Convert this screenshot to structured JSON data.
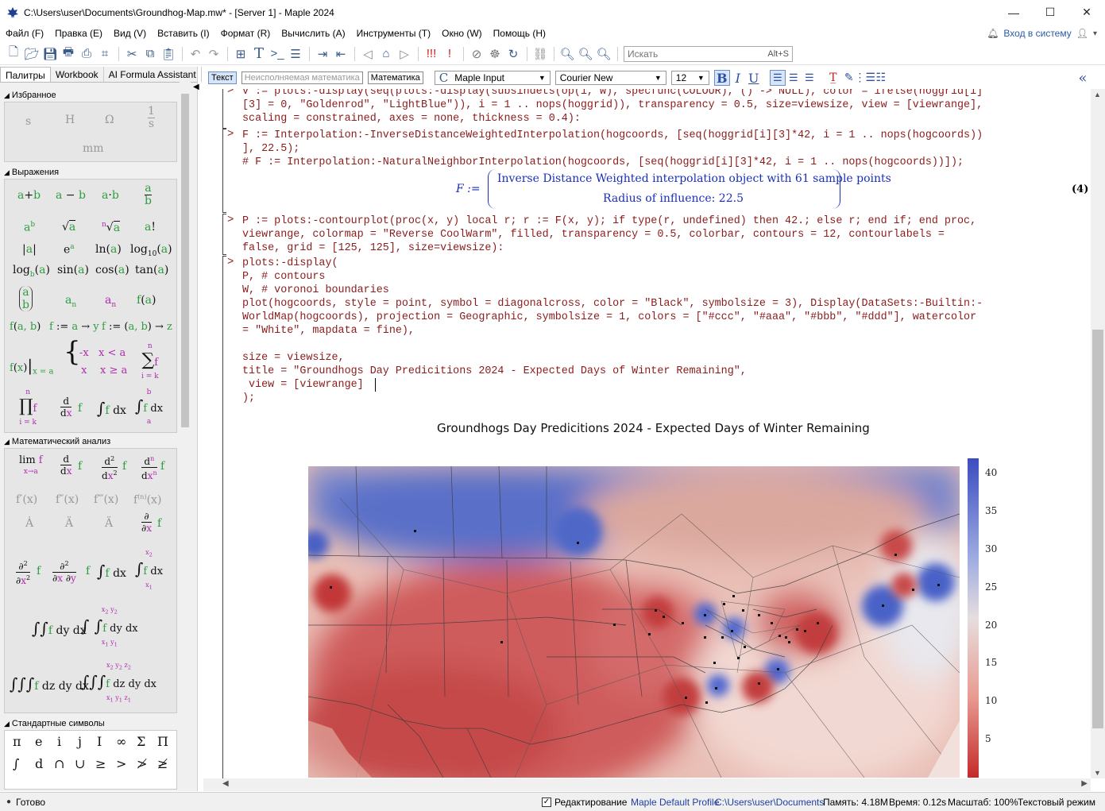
{
  "window": {
    "title": "C:\\Users\\user\\Documents\\Groundhog-Map.mw* - [Server 1] - Maple 2024",
    "minimize": "—",
    "maximize": "☐",
    "close": "✕"
  },
  "menu": [
    "Файл (F)",
    "Правка (E)",
    "Вид (V)",
    "Вставить (I)",
    "Формат (R)",
    "Вычислить (A)",
    "Инструменты (T)",
    "Окно (W)",
    "Помощь (H)"
  ],
  "login": "Вход в систему",
  "search": {
    "placeholder": "Искать",
    "shortcut": "Alt+S"
  },
  "palette": {
    "tabs": [
      "Палитры",
      "Workbook",
      "AI Formula Assistant"
    ],
    "sections": {
      "favorites": "Избранное",
      "expressions": "Выражения",
      "calculus": "Математический анализ",
      "symbols": "Стандартные символы"
    },
    "favorites_items": [
      "s",
      "H",
      "Ω",
      "mm"
    ],
    "symbols_row1": [
      "π",
      "e",
      "i",
      "j",
      "I",
      "∞",
      "Σ",
      "Π"
    ],
    "symbols_row2": [
      "∫",
      "d",
      "∩",
      "∪",
      "≥",
      ">",
      "≯",
      "≱"
    ]
  },
  "format_bar": {
    "text_mode": "Текст",
    "nonexec_math": "Неисполняемая математика",
    "math_mode": "Математика",
    "style": "Maple Input",
    "font": "Courier New",
    "size": "12",
    "bold": "B",
    "italic": "I",
    "underline": "U"
  },
  "document": {
    "lines_block1": [
      "V := plots:-display(seq(plots:-display(subsindets(op(1, w), specfunc(COLOUR), () -> NULL), color = ifelse(hoggrid[i]",
      "[3] = 0, \"Goldenrod\", \"LightBlue\")), i = 1 .. nops(hoggrid)), transparency = 0.5, size=viewsize, view = [viewrange],",
      "scaling = constrained, axes = none, thickness = 0.4):"
    ],
    "lines_block2": [
      "F := Interpolation:-InverseDistanceWeightedInterpolation(hogcoords, [seq(hoggrid[i][3]*42, i = 1 .. nops(hogcoords))",
      "], 22.5);",
      "# F := Interpolation:-NaturalNeighborInterpolation(hogcoords, [seq(hoggrid[i][3]*42, i = 1 .. nops(hogcoords))]);"
    ],
    "output_lhs": "F :=",
    "output_line1": "Inverse Distance Weighted interpolation object with 61 sample points",
    "output_line2": "Radius of influence: 22.5",
    "equation_label": "(4)",
    "lines_block3": [
      "P := plots:-contourplot(proc(x, y) local r; r := F(x, y); if type(r, undefined) then 42.; else r; end if; end proc,",
      "viewrange, colormap = \"Reverse CoolWarm\", filled, transparency = 0.5, colorbar, contours = 12, contourlabels =",
      "false, grid = [125, 125], size=viewsize):"
    ],
    "lines_block4": [
      "plots:-display(",
      "P, # contours",
      "W, # voronoi boundaries",
      "plot(hogcoords, style = point, symbol = diagonalcross, color = \"Black\", symbolsize = 3), Display(DataSets:-Builtin:-",
      "WorldMap(hogcoords), projection = Geographic, symbolsize = 1, colors = [\"#ccc\", \"#aaa\", \"#bbb\", \"#ddd\"], watercolor",
      "= \"White\", mapdata = fine),",
      "",
      "size = viewsize,",
      "title = \"Groundhogs Day Predicitions 2024 - Expected Days of Winter Remaining\",",
      " view = [viewrange]",
      ");"
    ],
    "plot_title": "Groundhogs Day Predicitions 2024 - Expected Days of Winter Remaining"
  },
  "chart_data": {
    "type": "heatmap",
    "title": "Groundhogs Day Predicitions 2024 - Expected Days of Winter Remaining",
    "colormap": "Reverse CoolWarm",
    "colorbar_ticks": [
      40,
      35,
      30,
      25,
      20,
      15,
      10,
      5
    ],
    "colorbar_range": [
      0,
      42
    ],
    "colors": {
      "high": "#3b4cc0",
      "mid": "#dddddd",
      "low": "#b40426"
    }
  },
  "status": {
    "ready": "Готово",
    "editing": "Редактирование",
    "profile": "Maple Default Profile",
    "path": "C:\\Users\\user\\Documents",
    "memory": "Память: 4.18M",
    "time": "Время: 0.12s",
    "zoom": "Масштаб: 100%",
    "mode": "Текстовый режим"
  }
}
